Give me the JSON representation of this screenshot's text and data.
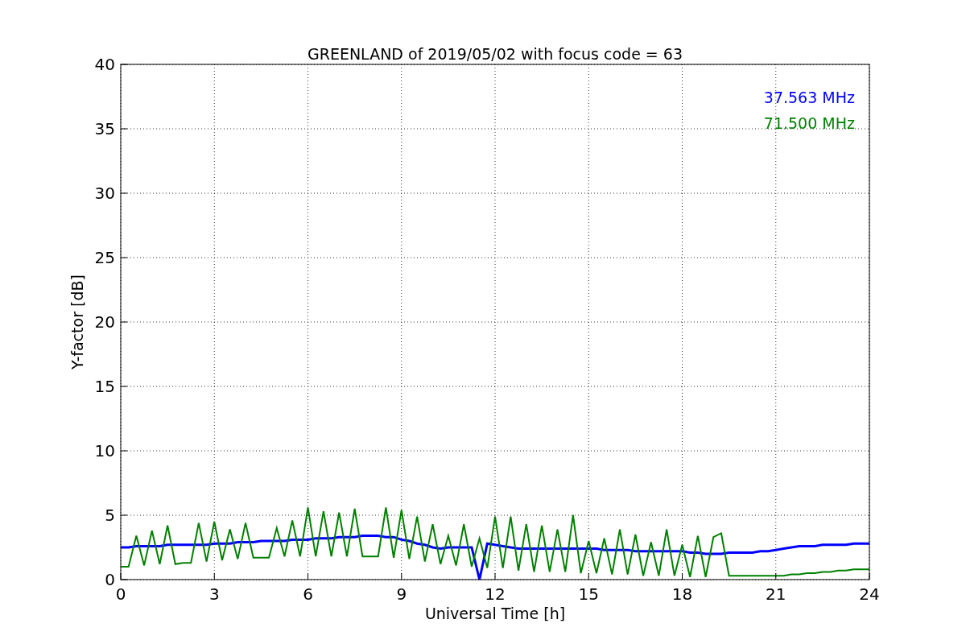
{
  "chart_data": {
    "type": "line",
    "title": "GREENLAND of 2019/05/02 with focus code = 63",
    "xlabel": "Universal Time [h]",
    "ylabel": "Y-factor [dB]",
    "x": [
      0,
      0.25,
      0.5,
      0.75,
      1,
      1.25,
      1.5,
      1.75,
      2,
      2.25,
      2.5,
      2.75,
      3,
      3.25,
      3.5,
      3.75,
      4,
      4.25,
      4.5,
      4.75,
      5,
      5.25,
      5.5,
      5.75,
      6,
      6.25,
      6.5,
      6.75,
      7,
      7.25,
      7.5,
      7.75,
      8,
      8.25,
      8.5,
      8.75,
      9,
      9.25,
      9.5,
      9.75,
      10,
      10.25,
      10.5,
      10.75,
      11,
      11.25,
      11.5,
      11.75,
      12,
      12.25,
      12.5,
      12.75,
      13,
      13.25,
      13.5,
      13.75,
      14,
      14.25,
      14.5,
      14.75,
      15,
      15.25,
      15.5,
      15.75,
      16,
      16.25,
      16.5,
      16.75,
      17,
      17.25,
      17.5,
      17.75,
      18,
      18.25,
      18.5,
      18.75,
      19,
      19.25,
      19.5,
      19.75,
      20,
      20.25,
      20.5,
      20.75,
      21,
      21.25,
      21.5,
      21.75,
      22,
      22.25,
      22.5,
      22.75,
      23,
      23.25,
      23.5,
      23.75,
      24
    ],
    "series": [
      {
        "name": "37.563 MHz",
        "color": "#0000ff",
        "values": [
          2.5,
          2.5,
          2.6,
          2.6,
          2.6,
          2.6,
          2.7,
          2.7,
          2.7,
          2.7,
          2.7,
          2.7,
          2.8,
          2.8,
          2.8,
          2.9,
          2.9,
          2.9,
          3.0,
          3.0,
          3.0,
          3.0,
          3.1,
          3.1,
          3.1,
          3.2,
          3.2,
          3.2,
          3.3,
          3.3,
          3.3,
          3.4,
          3.4,
          3.4,
          3.3,
          3.3,
          3.1,
          3.0,
          2.8,
          2.7,
          2.5,
          2.4,
          2.5,
          2.5,
          2.5,
          2.5,
          0,
          2.8,
          2.7,
          2.6,
          2.5,
          2.4,
          2.4,
          2.4,
          2.4,
          2.4,
          2.4,
          2.4,
          2.4,
          2.4,
          2.4,
          2.4,
          2.3,
          2.3,
          2.3,
          2.3,
          2.2,
          2.2,
          2.2,
          2.2,
          2.2,
          2.2,
          2.2,
          2.1,
          2.1,
          2.0,
          2.0,
          2.0,
          2.1,
          2.1,
          2.1,
          2.1,
          2.2,
          2.2,
          2.3,
          2.4,
          2.5,
          2.6,
          2.6,
          2.6,
          2.7,
          2.7,
          2.7,
          2.7,
          2.8,
          2.8,
          2.8
        ]
      },
      {
        "name": "71.500 MHz",
        "color": "#008000",
        "values": [
          1.0,
          1.0,
          3.4,
          1.1,
          3.8,
          1.2,
          4.2,
          1.2,
          1.3,
          1.3,
          4.4,
          1.4,
          4.5,
          1.5,
          3.9,
          1.6,
          4.4,
          1.7,
          1.7,
          1.7,
          4.0,
          1.8,
          4.6,
          1.8,
          5.6,
          1.8,
          5.3,
          1.8,
          5.2,
          1.8,
          5.5,
          1.8,
          1.8,
          1.8,
          5.6,
          1.7,
          5.4,
          1.6,
          4.9,
          1.4,
          4.3,
          1.2,
          3.4,
          1.1,
          4.3,
          1.0,
          3.2,
          0.9,
          4.9,
          0.9,
          4.9,
          0.7,
          4.3,
          0.6,
          4.2,
          0.6,
          3.9,
          0.6,
          5.0,
          0.5,
          3.0,
          0.5,
          3.2,
          0.4,
          3.9,
          0.4,
          3.5,
          0.3,
          2.9,
          0.3,
          3.9,
          0.3,
          2.7,
          0.2,
          3.4,
          0.2,
          3.3,
          3.6,
          0.3,
          0.3,
          0.3,
          0.3,
          0.3,
          0.3,
          0.3,
          0.3,
          0.4,
          0.4,
          0.5,
          0.5,
          0.6,
          0.6,
          0.7,
          0.7,
          0.8,
          0.8,
          0.8
        ]
      }
    ],
    "xlim": [
      0,
      24
    ],
    "ylim": [
      0,
      40
    ],
    "xticks": [
      0,
      3,
      6,
      9,
      12,
      15,
      18,
      21,
      24
    ],
    "yticks": [
      0,
      5,
      10,
      15,
      20,
      25,
      30,
      35,
      40
    ],
    "grid": true
  }
}
